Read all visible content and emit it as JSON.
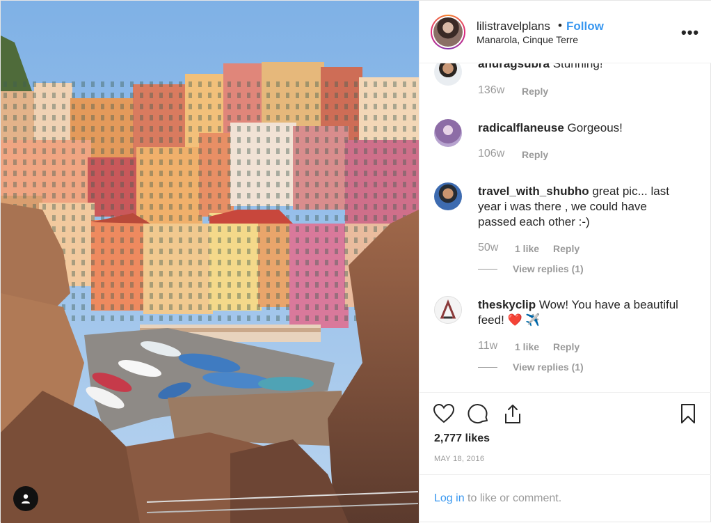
{
  "header": {
    "username": "lilistravelplans",
    "separator": "•",
    "follow_label": "Follow",
    "location": "Manarola, Cinque Terre",
    "more_label": "•••",
    "avatar_icon": "profile-avatar"
  },
  "comments": [
    {
      "username": "anuragsubra",
      "text": "Stunning!",
      "time": "136w",
      "likes": "",
      "reply_label": "Reply",
      "view_replies": ""
    },
    {
      "username": "radicalflaneuse",
      "text": "Gorgeous!",
      "time": "106w",
      "likes": "",
      "reply_label": "Reply",
      "view_replies": ""
    },
    {
      "username": "travel_with_shubho",
      "text": "great pic... last year i was there , we could have passed each other :-)",
      "time": "50w",
      "likes": "1 like",
      "reply_label": "Reply",
      "view_replies": "View replies (1)"
    },
    {
      "username": "theskyclip",
      "text": "Wow! You have a beautiful feed! ❤️ ✈️",
      "time": "11w",
      "likes": "1 like",
      "reply_label": "Reply",
      "view_replies": "View replies (1)"
    }
  ],
  "actions": {
    "like_icon": "heart-icon",
    "comment_icon": "comment-icon",
    "share_icon": "share-icon",
    "save_icon": "bookmark-icon",
    "likes_count": "2,777 likes",
    "date": "MAY 18, 2016"
  },
  "footer": {
    "login_label": "Log in",
    "suffix": " to like or comment."
  },
  "photo": {
    "tag_icon": "user-tag-icon"
  },
  "colors": {
    "link_blue": "#3897f0",
    "muted": "#999999",
    "text": "#262626"
  }
}
